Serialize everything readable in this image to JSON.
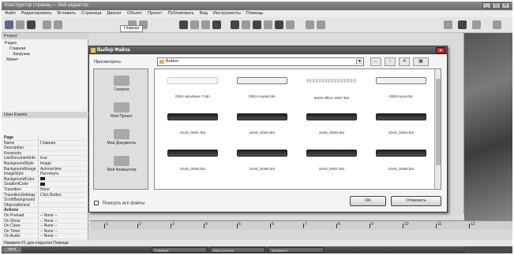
{
  "app": {
    "title": "Конструктор страниц — Веб-редактор",
    "menu": [
      "Файл",
      "Редактировать",
      "Вставить",
      "Страница",
      "Диалог",
      "Объект",
      "Проект",
      "Публиковать",
      "Вид",
      "Инструменты",
      "Помощь"
    ],
    "doc_tab": "Главная",
    "window_buttons": [
      "_",
      "□",
      "×"
    ]
  },
  "left_panel": {
    "project_header": "Project",
    "tree": [
      "Pages",
      "Главная",
      "Загрузка",
      "Макет"
    ],
    "user_events_header": "User Events",
    "properties": [
      {
        "name": "Page",
        "value": "",
        "section": true
      },
      {
        "name": "Name",
        "value": "Главная"
      },
      {
        "name": "Description",
        "value": ""
      },
      {
        "name": "Keywords",
        "value": ""
      },
      {
        "name": "UseDocumentInfo",
        "value": "true"
      },
      {
        "name": "BackgroundStyle",
        "value": "Image"
      },
      {
        "name": "BackgroundImage",
        "value": "Avtorun\\Ime"
      },
      {
        "name": "ImageStyle",
        "value": "Растянуть"
      },
      {
        "name": "BackgroundColor",
        "value": "color"
      },
      {
        "name": "GradientColor",
        "value": "color"
      },
      {
        "name": "Transition",
        "value": "None"
      },
      {
        "name": "TransitionSettings",
        "value": "Click Button"
      },
      {
        "name": "ScrollBackground",
        "value": ""
      },
      {
        "name": "ObjectsBehind",
        "value": ""
      },
      {
        "name": "Actions",
        "value": "",
        "section": true
      },
      {
        "name": "On Preload",
        "value": "-- None --"
      },
      {
        "name": "On Show",
        "value": "-- None --"
      },
      {
        "name": "On Close",
        "value": "-- None --"
      },
      {
        "name": "On Timer",
        "value": "-- None --"
      },
      {
        "name": "On Audio",
        "value": "-- None --"
      }
    ]
  },
  "dialog": {
    "title": "Выбор Файла",
    "look_in_label": "Просмотреть:",
    "look_in_value": "Button",
    "nav_buttons": [
      "←",
      "↑",
      "✳",
      "▦"
    ],
    "places": [
      "Галерея",
      "Мой Проект",
      "Мои Документы",
      "Мой Компьютер"
    ],
    "files": [
      {
        "name": "0001-windows-7.btn",
        "style": "light"
      },
      {
        "name": "0002-royale.btn",
        "style": "light"
      },
      {
        "name": "0003-office-2007.btn",
        "style": "blur"
      },
      {
        "name": "0004-luna.btn",
        "style": "light"
      },
      {
        "name": "1040_0001.btn",
        "style": "dark"
      },
      {
        "name": "1040_0002.btn",
        "style": "dark"
      },
      {
        "name": "1040_0003.btn",
        "style": "dark"
      },
      {
        "name": "1040_0004.btn",
        "style": "dark"
      },
      {
        "name": "1040_0005.btn",
        "style": "dark"
      },
      {
        "name": "1040_0006.btn",
        "style": "dark"
      },
      {
        "name": "1040_0007.btn",
        "style": "dark"
      },
      {
        "name": "1040_0008.btn",
        "style": "dark"
      }
    ],
    "show_all_label": "Показать все файлы",
    "ok_label": "OK",
    "cancel_label": "Отменить"
  },
  "status_bar": {
    "text": "Нажмите F1 для открытия Помощи"
  },
  "taskbar": {
    "start_label": "пуск",
    "items": [
      "Главная",
      "Конструктор",
      "Документ"
    ]
  },
  "ruler": {
    "numbers": [
      "1",
      "2",
      "3",
      "4",
      "5",
      "6",
      "7",
      "8",
      "9",
      "10",
      "11",
      "12"
    ]
  }
}
